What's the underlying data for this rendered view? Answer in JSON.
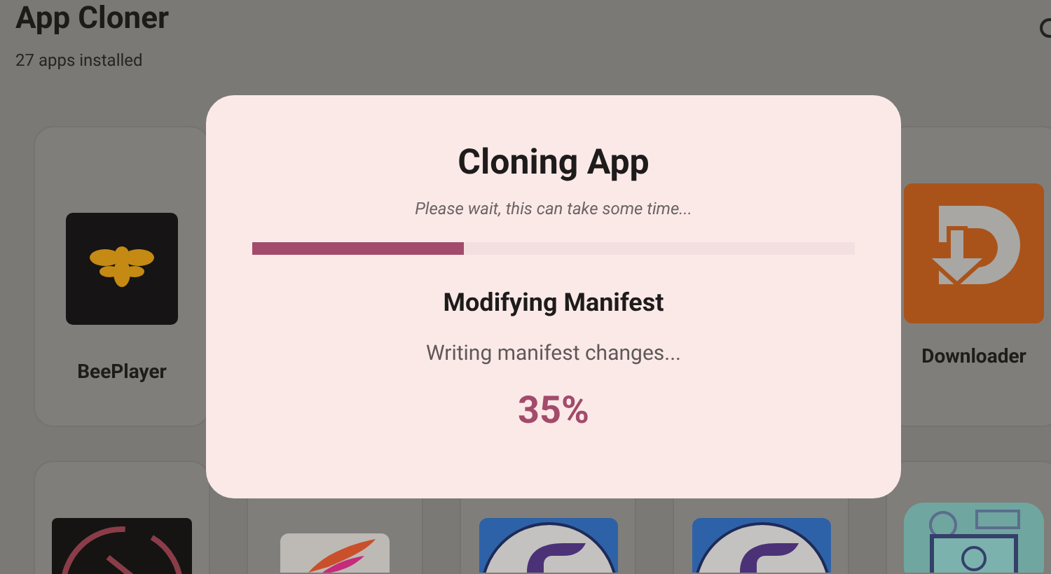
{
  "header": {
    "title": "App Cloner",
    "subtitle": "27 apps installed"
  },
  "apps": [
    {
      "kind": "bee",
      "name": "BeePlayer"
    },
    {
      "kind": "hidden"
    },
    {
      "kind": "hidden"
    },
    {
      "kind": "hidden"
    },
    {
      "kind": "download",
      "name": "Downloader"
    },
    {
      "kind": "play"
    },
    {
      "kind": "wing"
    },
    {
      "kind": "circle-f"
    },
    {
      "kind": "circle-f"
    },
    {
      "kind": "scene"
    }
  ],
  "dialog": {
    "title": "Cloning App",
    "note": "Please wait, this can take some time...",
    "progress": {
      "level": 0.35
    },
    "step": "Modifying Manifest",
    "detail": "Writing manifest changes...",
    "percent": "35%"
  }
}
